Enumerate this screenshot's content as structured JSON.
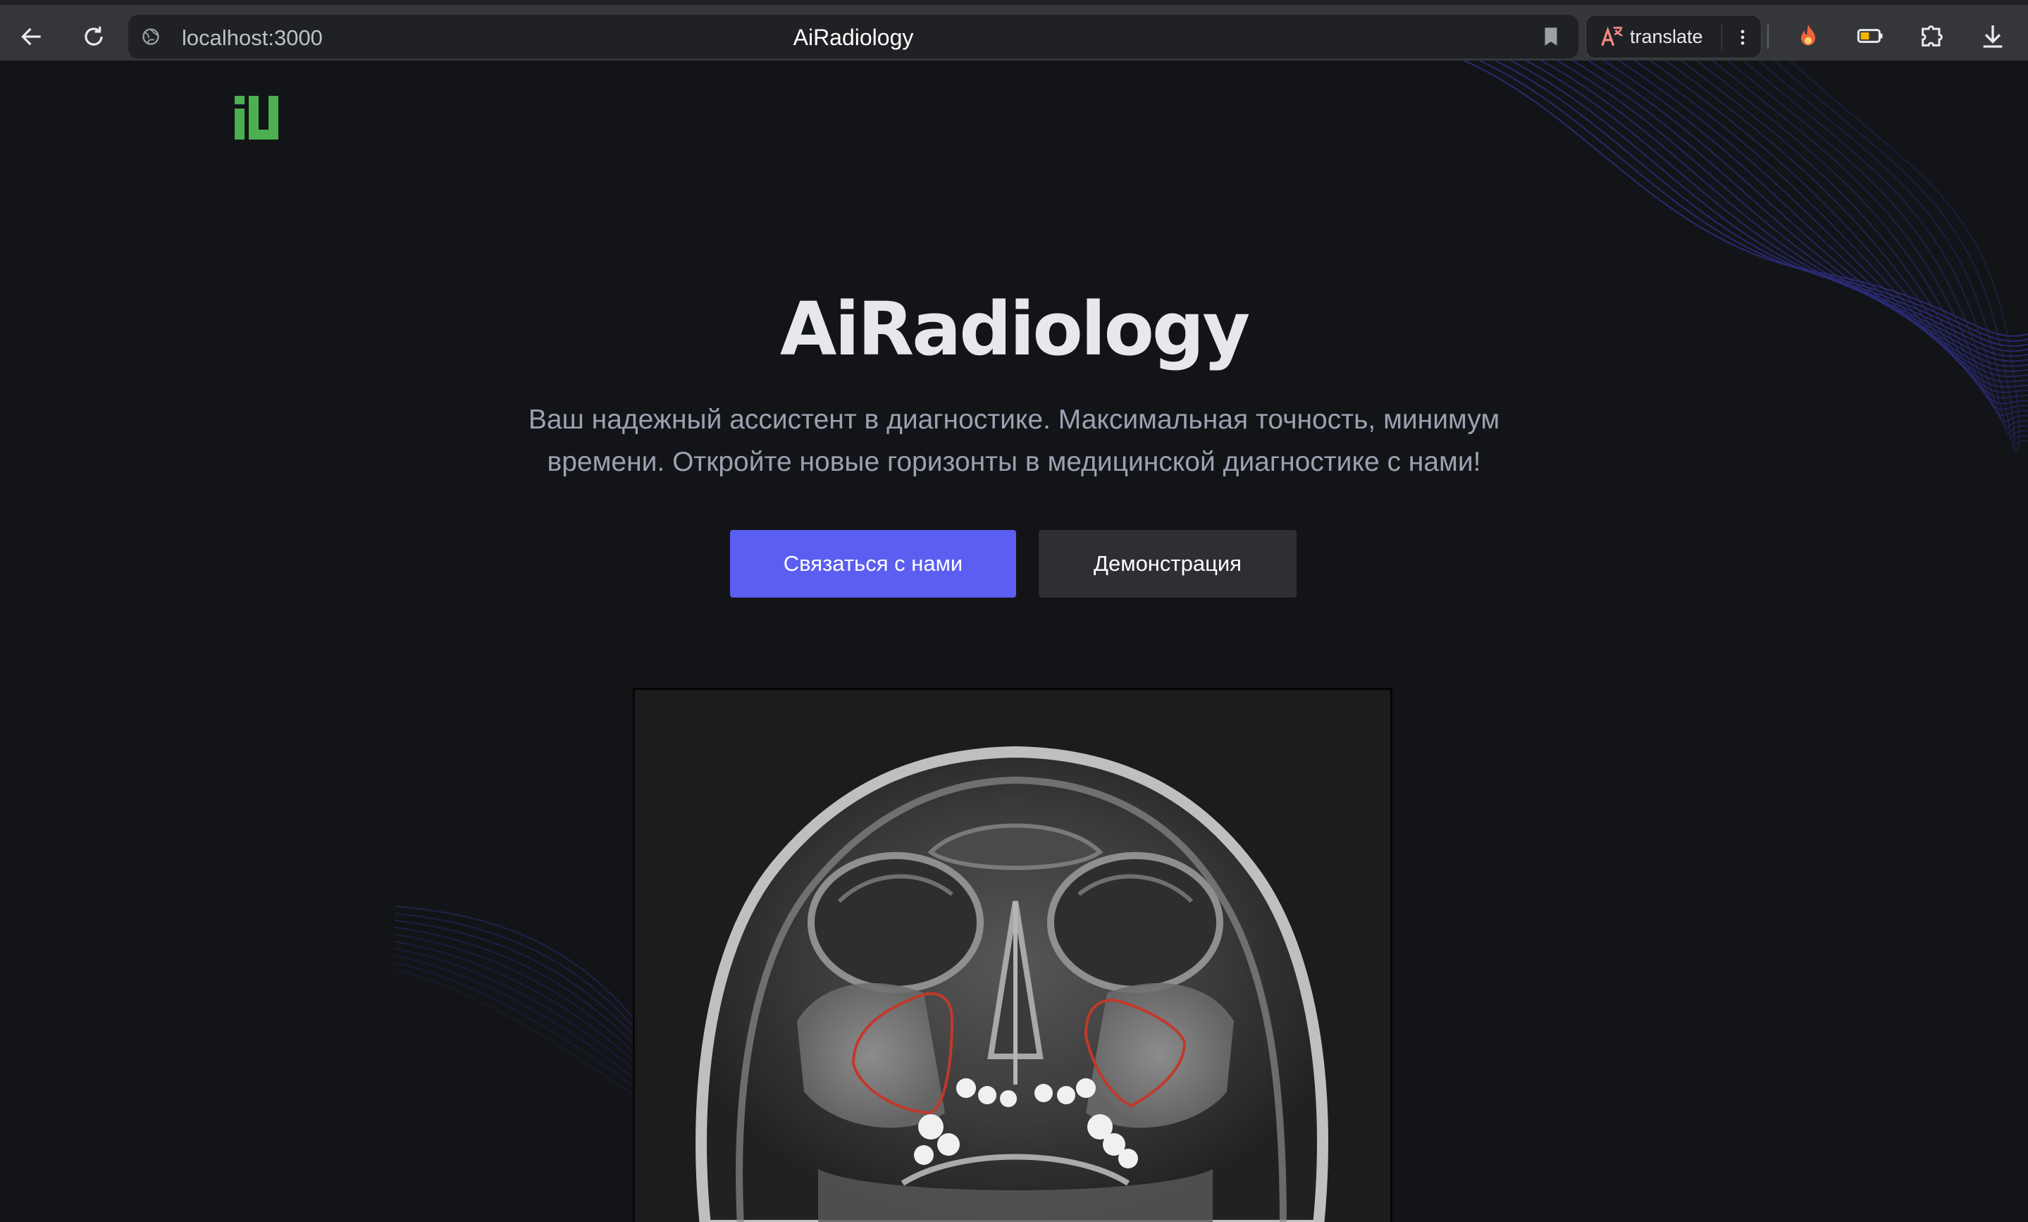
{
  "browser": {
    "url": "localhost:3000",
    "tab_title": "AiRadiology",
    "translate_label": "translate",
    "icons": [
      "back-arrow-icon",
      "reload-icon",
      "site-info-icon",
      "bookmark-icon",
      "translate-icon",
      "more-vert-icon",
      "fire-extension-icon",
      "battery-extension-icon",
      "puzzle-extension-icon",
      "download-icon"
    ],
    "colors": {
      "chrome": "#35363a",
      "omnibox": "#202124",
      "translate_accent": "#f28b82"
    }
  },
  "page": {
    "logo": "iU",
    "hero": {
      "title": "AiRadiology",
      "subtitle": "Ваш надежный ассистент в диагностике. Максимальная точность, минимум времени. Откройте новые горизонты в медицинской диагностике с нами!"
    },
    "buttons": {
      "contact": "Связаться с нами",
      "demo": "Демонстрация"
    },
    "image": {
      "subject": "skull-xray",
      "annotation_color": "#c0392b"
    },
    "colors": {
      "background": "#131417",
      "primary": "#5b5ef0",
      "secondary": "#2d2f33",
      "logo_green": "#4caf50",
      "wave_lines": "#2b2d7a"
    }
  }
}
